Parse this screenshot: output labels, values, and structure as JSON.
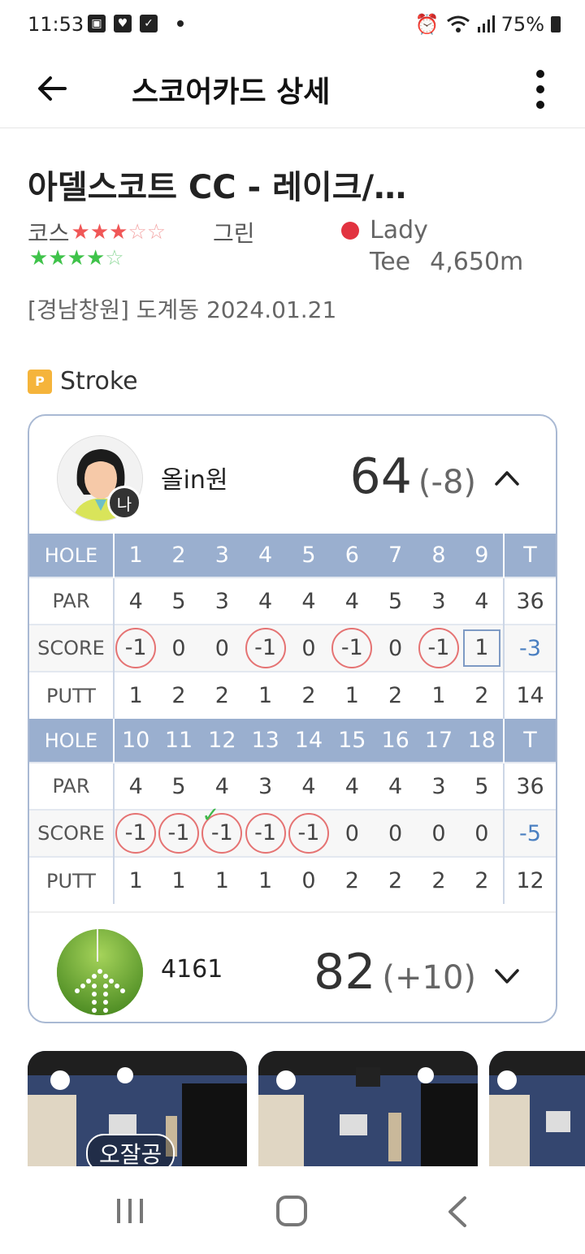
{
  "status": {
    "time": "11:53",
    "battery": "75%"
  },
  "appbar": {
    "title": "스코어카드 상세"
  },
  "course": {
    "name": "아델스코트 CC - 레이크/…",
    "course_label": "코스",
    "course_rating": 3,
    "green_label": "그린",
    "green_rating": 4,
    "tee_color": "#e23340",
    "tee_name": "Lady",
    "tee_word": "Tee",
    "tee_length": "4,650m",
    "location": "[경남창원] 도계동 2024.01.21"
  },
  "mode": {
    "icon": "P",
    "label": "Stroke"
  },
  "players": [
    {
      "name": "올in원",
      "badge": "나",
      "total": "64",
      "diff": "(-8)",
      "expanded": true
    },
    {
      "name": "4161",
      "total": "82",
      "diff": "(+10)",
      "expanded": false
    }
  ],
  "scorecard": {
    "labels": {
      "hole": "HOLE",
      "par": "PAR",
      "score": "SCORE",
      "putt": "PUTT",
      "total": "T"
    },
    "front": {
      "holes": [
        "1",
        "2",
        "3",
        "4",
        "5",
        "6",
        "7",
        "8",
        "9"
      ],
      "par": [
        "4",
        "5",
        "3",
        "4",
        "4",
        "4",
        "5",
        "3",
        "4"
      ],
      "par_total": "36",
      "score": [
        "-1",
        "0",
        "0",
        "-1",
        "0",
        "-1",
        "0",
        "-1",
        "1"
      ],
      "score_total": "-3",
      "putt": [
        "1",
        "2",
        "2",
        "1",
        "2",
        "1",
        "2",
        "1",
        "2"
      ],
      "putt_total": "14"
    },
    "back": {
      "holes": [
        "10",
        "11",
        "12",
        "13",
        "14",
        "15",
        "16",
        "17",
        "18"
      ],
      "par": [
        "4",
        "5",
        "4",
        "3",
        "4",
        "4",
        "4",
        "3",
        "5"
      ],
      "par_total": "36",
      "score": [
        "-1",
        "-1",
        "-1",
        "-1",
        "-1",
        "0",
        "0",
        "0",
        "0"
      ],
      "score_total": "-5",
      "putt": [
        "1",
        "1",
        "1",
        "1",
        "0",
        "2",
        "2",
        "2",
        "2"
      ],
      "putt_total": "12"
    }
  },
  "thumbnails": {
    "first_badge": "오잘공"
  }
}
